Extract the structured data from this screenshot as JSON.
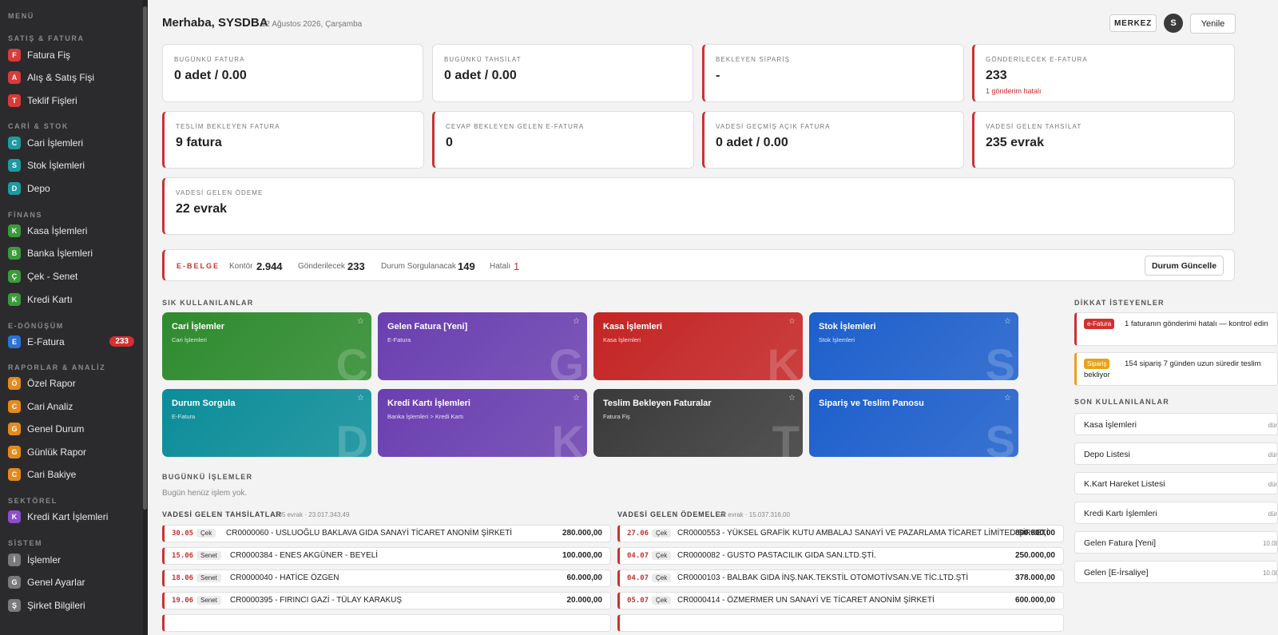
{
  "sidebar": {
    "menu_title": "MENÜ",
    "sections": {
      "satis": "SATIŞ & FATURA",
      "cari": "CARİ & STOK",
      "finans": "FİNANS",
      "edonusum": "E-DÖNÜŞÜM",
      "raporlar": "RAPORLAR & ANALİZ",
      "sektorel": "SEKTÖREL",
      "sistem": "SİSTEM"
    },
    "items": [
      {
        "letter": "F",
        "label": "Fatura Fiş",
        "color": "#d93a3a"
      },
      {
        "letter": "A",
        "label": "Alış & Satış Fişi",
        "color": "#d93a3a"
      },
      {
        "letter": "T",
        "label": "Teklif Fişleri",
        "color": "#d93a3a"
      },
      {
        "letter": "C",
        "label": "Cari İşlemleri",
        "color": "#1f9aa0"
      },
      {
        "letter": "S",
        "label": "Stok İşlemleri",
        "color": "#1f9aa0"
      },
      {
        "letter": "D",
        "label": "Depo",
        "color": "#1f9aa0"
      },
      {
        "letter": "K",
        "label": "Kasa İşlemleri",
        "color": "#3c9a3c"
      },
      {
        "letter": "B",
        "label": "Banka İşlemleri",
        "color": "#3c9a3c"
      },
      {
        "letter": "Ç",
        "label": "Çek - Senet",
        "color": "#3c9a3c"
      },
      {
        "letter": "K",
        "label": "Kredi Kartı",
        "color": "#3c9a3c"
      },
      {
        "letter": "E",
        "label": "E-Fatura",
        "color": "#2c72d6",
        "count": "233"
      },
      {
        "letter": "Ö",
        "label": "Özel Rapor",
        "color": "#e38a1e"
      },
      {
        "letter": "C",
        "label": "Cari Analiz",
        "color": "#e38a1e"
      },
      {
        "letter": "G",
        "label": "Genel Durum",
        "color": "#e38a1e"
      },
      {
        "letter": "G",
        "label": "Günlük Rapor",
        "color": "#e38a1e"
      },
      {
        "letter": "C",
        "label": "Cari Bakiye",
        "color": "#e38a1e"
      },
      {
        "letter": "K",
        "label": "Kredi Kart İşlemleri",
        "color": "#8a4fc9"
      },
      {
        "letter": "İ",
        "label": "İşlemler",
        "color": "#7a7a7a"
      },
      {
        "letter": "G",
        "label": "Genel Ayarlar",
        "color": "#7a7a7a"
      },
      {
        "letter": "Ş",
        "label": "Şirket Bilgileri",
        "color": "#7a7a7a"
      }
    ]
  },
  "header": {
    "greeting": "Merhaba, SYSDBA",
    "date": "12 Ağustos 2026, Çarşamba",
    "merkez_label": "MERKEZ",
    "avatar_letter": "S",
    "refresh_label": "Yenile"
  },
  "stats": [
    {
      "title": "BUGÜNKÜ FATURA",
      "value": "0 adet / 0.00",
      "sub": ""
    },
    {
      "title": "BUGÜNKÜ TAHSİLAT",
      "value": "0 adet / 0.00",
      "sub": ""
    },
    {
      "title": "BEKLEYEN SİPARİŞ",
      "value": "-",
      "sub": ""
    },
    {
      "title": "GÖNDERİLECEK E-FATURA",
      "value": "233",
      "sub": "1 gönderim hatalı"
    },
    {
      "title": "TESLİM BEKLEYEN FATURA",
      "value": "9 fatura",
      "sub": ""
    },
    {
      "title": "CEVAP BEKLEYEN GELEN E-FATURA",
      "value": "0",
      "sub": ""
    },
    {
      "title": "VADESİ GEÇMİŞ AÇIK FATURA",
      "value": "0 adet / 0.00",
      "sub": ""
    },
    {
      "title": "VADESİ GELEN TAHSİLAT",
      "value": "235 evrak",
      "sub": ""
    },
    {
      "title": "VADESİ GELEN ÖDEME",
      "value": "22 evrak",
      "sub": ""
    }
  ],
  "ebelge": {
    "title": "E-BELGE",
    "kontor_label": "Kontör",
    "kontor_value": "2.944",
    "gonderilecek_label": "Gönderilecek",
    "gonderilecek_value": "233",
    "sorgu_label": "Durum Sorgulanacak",
    "sorgu_value": "149",
    "hatali_label": "Hatalı",
    "hatali_value": "1",
    "button": "Durum Güncelle"
  },
  "favorites": {
    "title": "SIK KULLANILANLAR",
    "tiles": [
      {
        "title": "Cari İşlemler",
        "sub": "Cari İşlemleri",
        "letter": "C",
        "color": "#2e8b2e"
      },
      {
        "title": "Gelen Fatura [Yeni]",
        "sub": "E-Fatura",
        "letter": "G",
        "color": "#6a3fb0"
      },
      {
        "title": "Kasa İşlemleri",
        "sub": "Kasa İşlemleri",
        "letter": "K",
        "color": "#c42424"
      },
      {
        "title": "Stok İşlemleri",
        "sub": "Stok İşlemleri",
        "letter": "S",
        "color": "#1d5fcc"
      },
      {
        "title": "Durum Sorgula",
        "sub": "E-Fatura",
        "letter": "D",
        "color": "#0b8d99"
      },
      {
        "title": "Kredi Kartı İşlemleri",
        "sub": "Banka İşlemleri > Kredi Kartı",
        "letter": "K",
        "color": "#6a3fb0"
      },
      {
        "title": "Teslim Bekleyen Faturalar",
        "sub": "Fatura Fiş",
        "letter": "T",
        "color": "#3a3a3a"
      },
      {
        "title": "Sipariş ve Teslim Panosu",
        "sub": "",
        "letter": "S",
        "color": "#1d5fcc"
      }
    ]
  },
  "today": {
    "title": "BUGÜNKÜ İŞLEMLER",
    "empty": "Bugün henüz işlem yok."
  },
  "collections": {
    "title": "VADESİ GELEN TAHSİLATLAR",
    "meta": "235 evrak · 23.017.343,49",
    "rows": [
      {
        "date": "30.05",
        "type": "Çek",
        "desc": "CR0000060 - USLUOĞLU BAKLAVA GIDA SANAYİ TİCARET ANONİM ŞİRKETİ",
        "amount": "280.000,00"
      },
      {
        "date": "15.06",
        "type": "Senet",
        "desc": "CR0000384 - ENES AKGÜNER - BEYELİ",
        "amount": "100.000,00"
      },
      {
        "date": "18.06",
        "type": "Senet",
        "desc": "CR0000040 - HATİCE ÖZGEN",
        "amount": "60.000,00"
      },
      {
        "date": "19.06",
        "type": "Senet",
        "desc": "CR0000395 - FIRINCI GAZİ - TÜLAY KARAKUŞ",
        "amount": "20.000,00"
      }
    ]
  },
  "payments": {
    "title": "VADESİ GELEN ÖDEMELER",
    "meta": "22 evrak · 15.037.316,00",
    "rows": [
      {
        "date": "27.06",
        "type": "Çek",
        "desc": "CR0000553 - YÜKSEL GRAFİK KUTU AMBALAJ SANAYİ VE PAZARLAMA TİCARET LİMİTED ŞİRKETİ",
        "amount": "800.000,00"
      },
      {
        "date": "04.07",
        "type": "Çek",
        "desc": "CR0000082 - GUSTO PASTACILIK GIDA SAN.LTD.ŞTİ.",
        "amount": "250.000,00"
      },
      {
        "date": "04.07",
        "type": "Çek",
        "desc": "CR0000103 - BALBAK GIDA İNŞ.NAK.TEKSTİL OTOMOTİVSAN.VE TİC.LTD.ŞTİ",
        "amount": "378.000,00"
      },
      {
        "date": "05.07",
        "type": "Çek",
        "desc": "CR0000414 - ÖZMERMER UN SANAYİ VE TİCARET ANONİM ŞİRKETİ",
        "amount": "600.000,00"
      }
    ]
  },
  "attention": {
    "title": "DİKKAT İSTEYENLER",
    "items": [
      {
        "tag": "e-Fatura",
        "tag_color": "#d23030",
        "text": "1 faturanın gönderimi hatalı — kontrol edin"
      },
      {
        "tag": "Sipariş",
        "tag_color": "#e8a21a",
        "text": "154 sipariş 7 günden uzun süredir teslim bekliyor"
      }
    ]
  },
  "recent": {
    "title": "SON KULLANILANLAR",
    "items": [
      {
        "label": "Kasa İşlemleri",
        "time": "dün"
      },
      {
        "label": "Depo Listesi",
        "time": "dün"
      },
      {
        "label": "K.Kart Hareket Listesi",
        "time": "dün"
      },
      {
        "label": "Kredi Kartı İşlemleri",
        "time": "dün"
      },
      {
        "label": "Gelen Fatura [Yeni]",
        "time": "10.08"
      },
      {
        "label": "Gelen [E-İrsaliye]",
        "time": "10.08"
      }
    ]
  }
}
